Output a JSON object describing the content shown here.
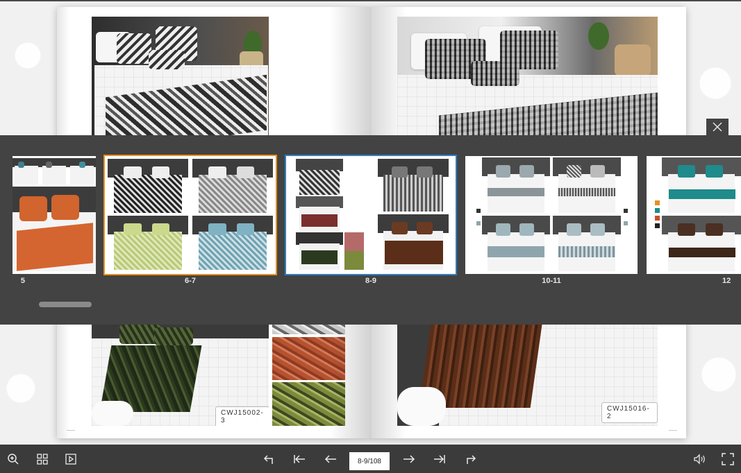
{
  "book": {
    "left_page_code": "CWJ15002-3",
    "right_page_code": "CWJ15016-2"
  },
  "thumbnails": {
    "items": [
      {
        "label": "5",
        "selected": false
      },
      {
        "label": "6-7",
        "selected": true,
        "highlight": "#e8901e"
      },
      {
        "label": "8-9",
        "selected": true,
        "highlight": "#2f7fc1"
      },
      {
        "label": "10-11",
        "selected": false
      },
      {
        "label": "12",
        "selected": false
      }
    ]
  },
  "toolbar": {
    "page_indicator": "8-9/108",
    "left_icons": [
      "zoom-in-icon",
      "grid-icon",
      "autoplay-icon"
    ],
    "center_icons": [
      "back-icon",
      "first-page-icon",
      "previous-page-icon",
      "next-page-icon",
      "last-page-icon",
      "share-icon"
    ],
    "right_icons": [
      "sound-icon",
      "fullscreen-icon"
    ]
  },
  "colors": {
    "panel_bg": "#434343",
    "toolbar_bg": "#3b3b3b",
    "thumb_selected_orange": "#e8901e",
    "thumb_selected_blue": "#2f7fc1"
  }
}
